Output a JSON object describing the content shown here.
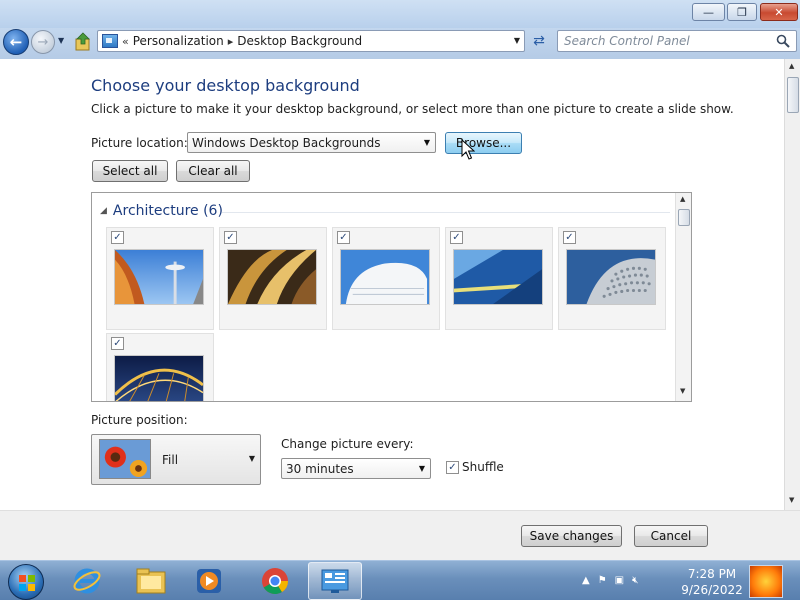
{
  "window": {
    "minimize_glyph": "—",
    "maximize_glyph": "❐",
    "close_glyph": "✕"
  },
  "nav": {
    "back_glyph": "←",
    "forward_glyph": "→",
    "breadcrumb_sep": "«",
    "breadcrumb": [
      "Personalization",
      "Desktop Background"
    ],
    "crumb_arrow": "▸",
    "refresh_glyph": "⇄",
    "search_placeholder": "Search Control Panel"
  },
  "page": {
    "heading": "Choose your desktop background",
    "subtext": "Click a picture to make it your desktop background, or select more than one picture to create a slide show.",
    "location_label": "Picture location:",
    "location_value": "Windows Desktop Backgrounds",
    "browse_label": "Browse...",
    "select_all_label": "Select all",
    "clear_all_label": "Clear all",
    "group": {
      "name": "Architecture (6)",
      "items": [
        {
          "checked": true,
          "theme": "needle-tower"
        },
        {
          "checked": true,
          "theme": "golden-curves"
        },
        {
          "checked": true,
          "theme": "white-building"
        },
        {
          "checked": true,
          "theme": "blue-facade"
        },
        {
          "checked": true,
          "theme": "dotted-dome"
        },
        {
          "checked": true,
          "theme": "night-arch"
        }
      ]
    },
    "position_label": "Picture position:",
    "position_value": "Fill",
    "change_label": "Change picture every:",
    "interval_value": "30 minutes",
    "shuffle_label": "Shuffle",
    "shuffle_checked": true,
    "save_label": "Save changes",
    "cancel_label": "Cancel"
  },
  "taskbar": {
    "items": [
      "internet-explorer",
      "windows-explorer",
      "media-player",
      "chrome",
      "control-panel"
    ],
    "active_item": "control-panel",
    "time": "7:28 PM",
    "date": "9/26/2022"
  },
  "colors": {
    "heading": "#1d3d7f",
    "accent_button": "#a9dcf6",
    "titlebar": "#cfe0f3"
  }
}
